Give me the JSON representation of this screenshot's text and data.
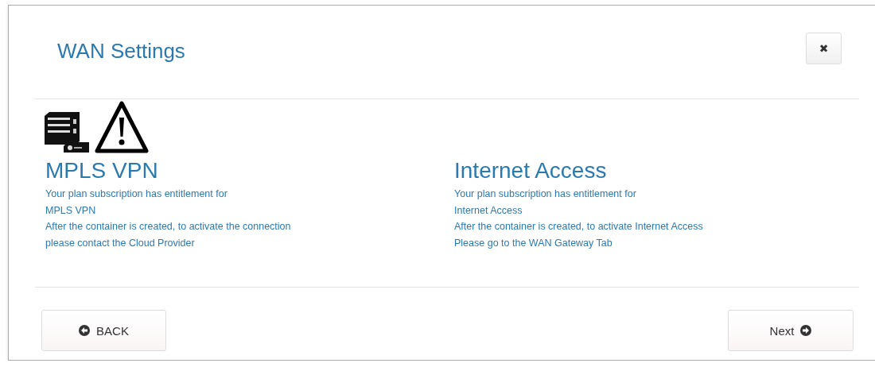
{
  "dialog": {
    "title": "WAN Settings",
    "close": "✖"
  },
  "sections": [
    {
      "heading": "MPLS VPN",
      "lines": [
        "Your plan subscription has entitlement for",
        "MPLS VPN",
        "After the container is created, to activate the connection",
        "please contact the Cloud Provider"
      ]
    },
    {
      "heading": "Internet Access",
      "lines": [
        "Your plan subscription has entitlement for",
        "Internet Access",
        "After the container is created, to activate Internet Access",
        "Please go to the WAN Gateway Tab"
      ]
    }
  ],
  "buttons": [
    {
      "label": "BACK",
      "kind": "back"
    },
    {
      "label": "Next",
      "kind": "next"
    }
  ]
}
